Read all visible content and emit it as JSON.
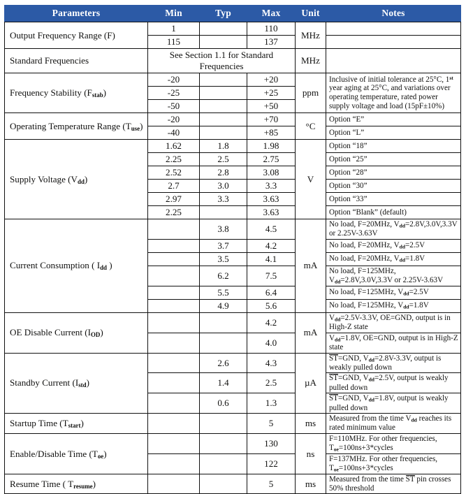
{
  "table": {
    "headers": [
      "Parameters",
      "Min",
      "Typ",
      "Max",
      "Unit",
      "Notes"
    ],
    "header_bg": "#2c5aa6",
    "header_fg": "#ffffff",
    "rows": [
      {
        "param_html": "Output Frequency Range (F)",
        "unit": "MHz",
        "lines": [
          {
            "min": "1",
            "typ": "",
            "max": "110",
            "note_html": ""
          },
          {
            "min": "115",
            "typ": "",
            "max": "137",
            "note_html": ""
          }
        ]
      },
      {
        "param_html": "Standard Frequencies",
        "unit": "MHz",
        "spanned_text": "See Section 1.1 for Standard Frequencies",
        "lines": [
          {
            "note_html": ""
          }
        ]
      },
      {
        "param_html": "Frequency Stability (F<sub>stab</sub>)",
        "unit": "ppm",
        "note_span_html": "Inclusive of initial tolerance at 25&deg;C, 1<sup>st</sup> year aging at 25&deg;C, and variations over operating temperature, rated power supply voltage and load (15pF&plusmn;10%)",
        "lines": [
          {
            "min": "-20",
            "typ": "",
            "max": "+20"
          },
          {
            "min": "-25",
            "typ": "",
            "max": "+25"
          },
          {
            "min": "-50",
            "typ": "",
            "max": "+50"
          }
        ]
      },
      {
        "param_html": "Operating Temperature Range (T<sub>use</sub>)",
        "unit": "&deg;C",
        "lines": [
          {
            "min": "-20",
            "typ": "",
            "max": "+70",
            "note_html": "Option &ldquo;E&rdquo;"
          },
          {
            "min": "-40",
            "typ": "",
            "max": "+85",
            "note_html": "Option &ldquo;L&rdquo;"
          }
        ]
      },
      {
        "param_html": "Supply Voltage (V<sub>dd</sub>)",
        "unit": "V",
        "lines": [
          {
            "min": "1.62",
            "typ": "1.8",
            "max": "1.98",
            "note_html": "Option &ldquo;18&rdquo;"
          },
          {
            "min": "2.25",
            "typ": "2.5",
            "max": "2.75",
            "note_html": "Option &ldquo;25&rdquo;"
          },
          {
            "min": "2.52",
            "typ": "2.8",
            "max": "3.08",
            "note_html": "Option &ldquo;28&rdquo;"
          },
          {
            "min": "2.7",
            "typ": "3.0",
            "max": "3.3",
            "note_html": "Option &ldquo;30&rdquo;"
          },
          {
            "min": "2.97",
            "typ": "3.3",
            "max": "3.63",
            "note_html": "Option &ldquo;33&rdquo;"
          },
          {
            "min": "2.25",
            "typ": "",
            "max": "3.63",
            "note_html": "Option &ldquo;Blank&rdquo; (default)"
          }
        ]
      },
      {
        "param_html": "Current Consumption ( I<sub>dd</sub> )",
        "unit": "mA",
        "lines": [
          {
            "min": "",
            "typ": "3.8",
            "max": "4.5",
            "note_html": "No load, F=20MHz, V<sub>dd</sub>=2.8V,3.0V,3.3V or 2.25V-3.63V"
          },
          {
            "min": "",
            "typ": "3.7",
            "max": "4.2",
            "note_html": "No load, F=20MHz, V<sub>dd</sub>=2.5V"
          },
          {
            "min": "",
            "typ": "3.5",
            "max": "4.1",
            "note_html": "No load, F=20MHz, V<sub>dd</sub>=1.8V"
          },
          {
            "min": "",
            "typ": "6.2",
            "max": "7.5",
            "note_html": "No load, F=125MHz, V<sub>dd</sub>=2.8V,3.0V,3.3V or 2.25V-3.63V"
          },
          {
            "min": "",
            "typ": "5.5",
            "max": "6.4",
            "note_html": "No load, F=125MHz, V<sub>dd</sub>=2.5V"
          },
          {
            "min": "",
            "typ": "4.9",
            "max": "5.6",
            "note_html": "No load, F=125MHz, V<sub>dd</sub>=1.8V"
          }
        ]
      },
      {
        "param_html": "OE Disable Current (I<sub>OD</sub>)",
        "unit": "mA",
        "lines": [
          {
            "min": "",
            "typ": "",
            "max": "4.2",
            "note_html": "V<sub>dd</sub>=2.5V-3.3V, OE=GND, output is in High-Z state"
          },
          {
            "min": "",
            "typ": "",
            "max": "4.0",
            "note_html": "V<sub>dd</sub>=1.8V, OE=GND, output is in High-Z state"
          }
        ]
      },
      {
        "param_html": "Standby Current (I<sub>std</sub>)",
        "unit": "&micro;A",
        "lines": [
          {
            "min": "",
            "typ": "2.6",
            "max": "4.3",
            "note_html": "<span class=\"ovl\">ST</span>=GND, V<sub>dd</sub>=2.8V-3.3V, output is weakly pulled down"
          },
          {
            "min": "",
            "typ": "1.4",
            "max": "2.5",
            "note_html": "<span class=\"ovl\">ST</span>=GND, V<sub>dd</sub>=2.5V, output is weakly pulled down"
          },
          {
            "min": "",
            "typ": "0.6",
            "max": "1.3",
            "note_html": "<span class=\"ovl\">ST</span>=GND, V<sub>dd</sub>=1.8V, output is weakly pulled down"
          }
        ]
      },
      {
        "param_html": "Startup Time (T<sub>start</sub>)",
        "unit": "ms",
        "lines": [
          {
            "min": "",
            "typ": "",
            "max": "5",
            "note_html": "Measured from the time V<sub>dd</sub> reaches its rated minimum value"
          }
        ]
      },
      {
        "param_html": "Enable/Disable Time (T<sub>oe</sub>)",
        "unit": "ns",
        "lines": [
          {
            "min": "",
            "typ": "",
            "max": "130",
            "note_html": "F=110MHz. For other frequencies, T<sub>oe</sub>=100ns+3*cycles"
          },
          {
            "min": "",
            "typ": "",
            "max": "122",
            "note_html": "F=137MHz. For other frequencies, T<sub>oe</sub>=100ns+3*cycles"
          }
        ]
      },
      {
        "param_html": "Resume Time ( T<sub>resume</sub>)",
        "unit": "ms",
        "lines": [
          {
            "min": "",
            "typ": "",
            "max": "5",
            "note_html": "Measured from the time <span class=\"ovl\">ST</span> pin crosses 50% threshold"
          }
        ]
      }
    ]
  }
}
